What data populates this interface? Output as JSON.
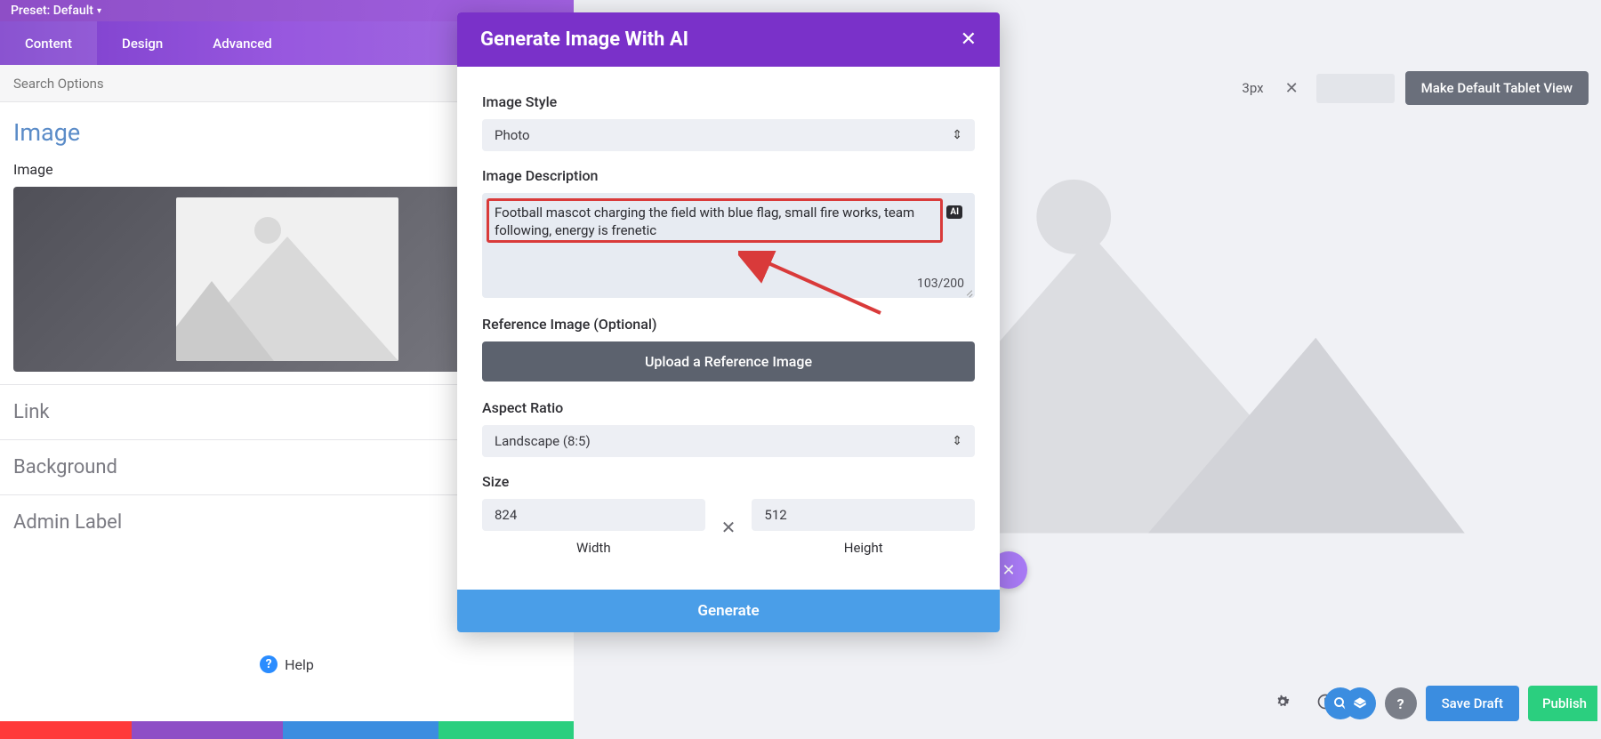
{
  "preset": {
    "label": "Preset: Default"
  },
  "tabs": {
    "content": "Content",
    "design": "Design",
    "advanced": "Advanced"
  },
  "search": {
    "placeholder": "Search Options"
  },
  "sections": {
    "image": "Image",
    "image_field": "Image",
    "link": "Link",
    "background": "Background",
    "admin_label": "Admin Label"
  },
  "help": {
    "label": "Help"
  },
  "header_right": {
    "px_value": "3px",
    "default_view": "Make Default Tablet View"
  },
  "bottom": {
    "save_draft": "Save Draft",
    "publish": "Publish"
  },
  "modal": {
    "title": "Generate Image With AI",
    "image_style_label": "Image Style",
    "image_style_value": "Photo",
    "description_label": "Image Description",
    "description_text": "Football mascot charging the field with blue flag, small fire works, team following, energy is frenetic",
    "char_count": "103/200",
    "ai_badge": "AI",
    "reference_label": "Reference Image (Optional)",
    "upload_button": "Upload a Reference Image",
    "aspect_label": "Aspect Ratio",
    "aspect_value": "Landscape (8:5)",
    "size_label": "Size",
    "width_value": "824",
    "height_value": "512",
    "width_sub": "Width",
    "height_sub": "Height",
    "generate": "Generate"
  }
}
